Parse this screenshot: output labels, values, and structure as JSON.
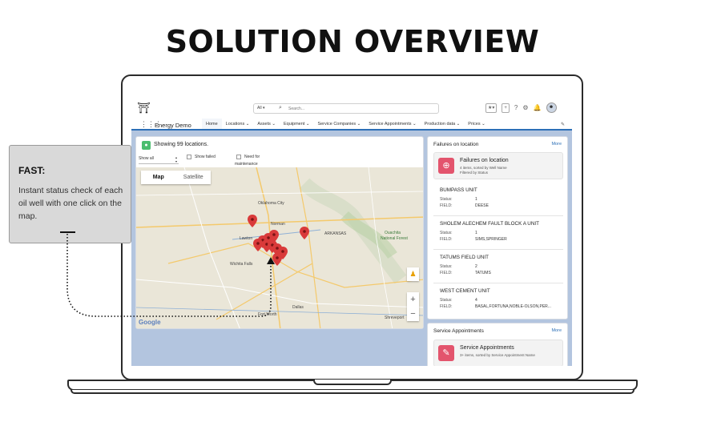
{
  "headline": "SOLUTION OVERVIEW",
  "callout": {
    "title": "FAST:",
    "body": "Instant status check of each oil well with one click on the map."
  },
  "header": {
    "search_scope": "All",
    "search_placeholder": "Search..."
  },
  "nav": {
    "app_name": "Energy Demo",
    "items": [
      {
        "label": "Home",
        "active": true
      },
      {
        "label": "Locations"
      },
      {
        "label": "Assets"
      },
      {
        "label": "Equipment"
      },
      {
        "label": "Service Companies"
      },
      {
        "label": "Service Appointments"
      },
      {
        "label": "Production data"
      },
      {
        "label": "Prices"
      }
    ]
  },
  "map_card": {
    "showing": "Showing 99 locations.",
    "filter_value": "Show all",
    "show_failed": "Show failed",
    "need_maintenance_line1": "Need for",
    "need_maintenance_line2": "maintenance",
    "tab_map": "Map",
    "tab_satellite": "Satellite",
    "google": "Google",
    "cities": {
      "oklahoma_city": "Oklahoma City",
      "norman": "Norman",
      "lawton": "Lawton",
      "wichita_falls": "Wichita Falls",
      "dallas": "Dallas",
      "fort_worth": "Fort Worth",
      "shreveport": "Shreveport",
      "national_forest": "National Forest",
      "ouachita": "Ouachita",
      "arkansas": "ARKANSAS"
    }
  },
  "failures": {
    "title": "Failures on location",
    "more": "More",
    "report_title": "Failures on location",
    "report_sub1": "4 items, sorted by Well Name",
    "report_sub2": "Filtered by Status",
    "status_label": "Status:",
    "field_label": "FIELD:",
    "items": [
      {
        "name": "BUMPASS UNIT",
        "status": "1",
        "field": "DEESE"
      },
      {
        "name": "SHOLEM ALECHEM FAULT BLOCK A UNIT",
        "status": "1",
        "field": "SIMS,SPRINGER"
      },
      {
        "name": "TATUMS FIELD UNIT",
        "status": "2",
        "field": "TATUMS"
      },
      {
        "name": "WEST CEMENT UNIT",
        "status": "4",
        "field": "BASAL,FORTUNA,NOBLE-OLSON,PER..."
      }
    ]
  },
  "service": {
    "title": "Service Appointments",
    "more": "More",
    "report_title": "Service Appointments",
    "report_sub": "3+ items, sorted by Service Appointment Name"
  },
  "colors": {
    "accent": "#2c6fb7",
    "pin": "#d93a3a",
    "failure_icon": "#e3546d",
    "map_background": "#eae6d8"
  }
}
